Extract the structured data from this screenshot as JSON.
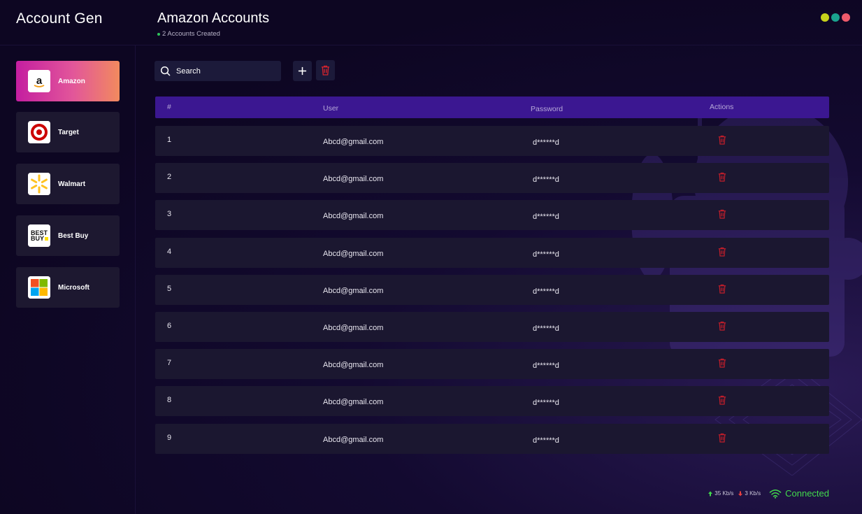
{
  "app": {
    "title": "Account Gen",
    "window_dots": [
      "#c7d21b",
      "#1aa38f",
      "#ee5a6b"
    ]
  },
  "sidebar": {
    "items": [
      {
        "label": "Amazon",
        "icon": "amazon-logo",
        "active": true
      },
      {
        "label": "Target",
        "icon": "target-logo",
        "active": false
      },
      {
        "label": "Walmart",
        "icon": "walmart-logo",
        "active": false
      },
      {
        "label": "Best Buy",
        "icon": "bestbuy-logo",
        "active": false
      },
      {
        "label": "Microsoft",
        "icon": "microsoft-logo",
        "active": false
      }
    ]
  },
  "header": {
    "title": "Amazon Accounts",
    "subtitle": "2 Accounts Created"
  },
  "toolbar": {
    "search_placeholder": "Search",
    "add_icon": "plus-icon",
    "delete_icon": "trash-icon"
  },
  "table": {
    "columns": [
      "#",
      "User",
      "Password",
      "Actions"
    ],
    "rows": [
      {
        "num": "1",
        "user": "Abcd@gmail.com",
        "password": "d******d"
      },
      {
        "num": "2",
        "user": "Abcd@gmail.com",
        "password": "d******d"
      },
      {
        "num": "3",
        "user": "Abcd@gmail.com",
        "password": "d******d"
      },
      {
        "num": "4",
        "user": "Abcd@gmail.com",
        "password": "d******d"
      },
      {
        "num": "5",
        "user": "Abcd@gmail.com",
        "password": "d******d"
      },
      {
        "num": "6",
        "user": "Abcd@gmail.com",
        "password": "d******d"
      },
      {
        "num": "7",
        "user": "Abcd@gmail.com",
        "password": "d******d"
      },
      {
        "num": "8",
        "user": "Abcd@gmail.com",
        "password": "d******d"
      },
      {
        "num": "9",
        "user": "Abcd@gmail.com",
        "password": "d******d"
      }
    ]
  },
  "status": {
    "upload": "35 Kb/s",
    "download": "3 Kb/s",
    "connection": "Connected",
    "connection_color": "#42d94c"
  }
}
